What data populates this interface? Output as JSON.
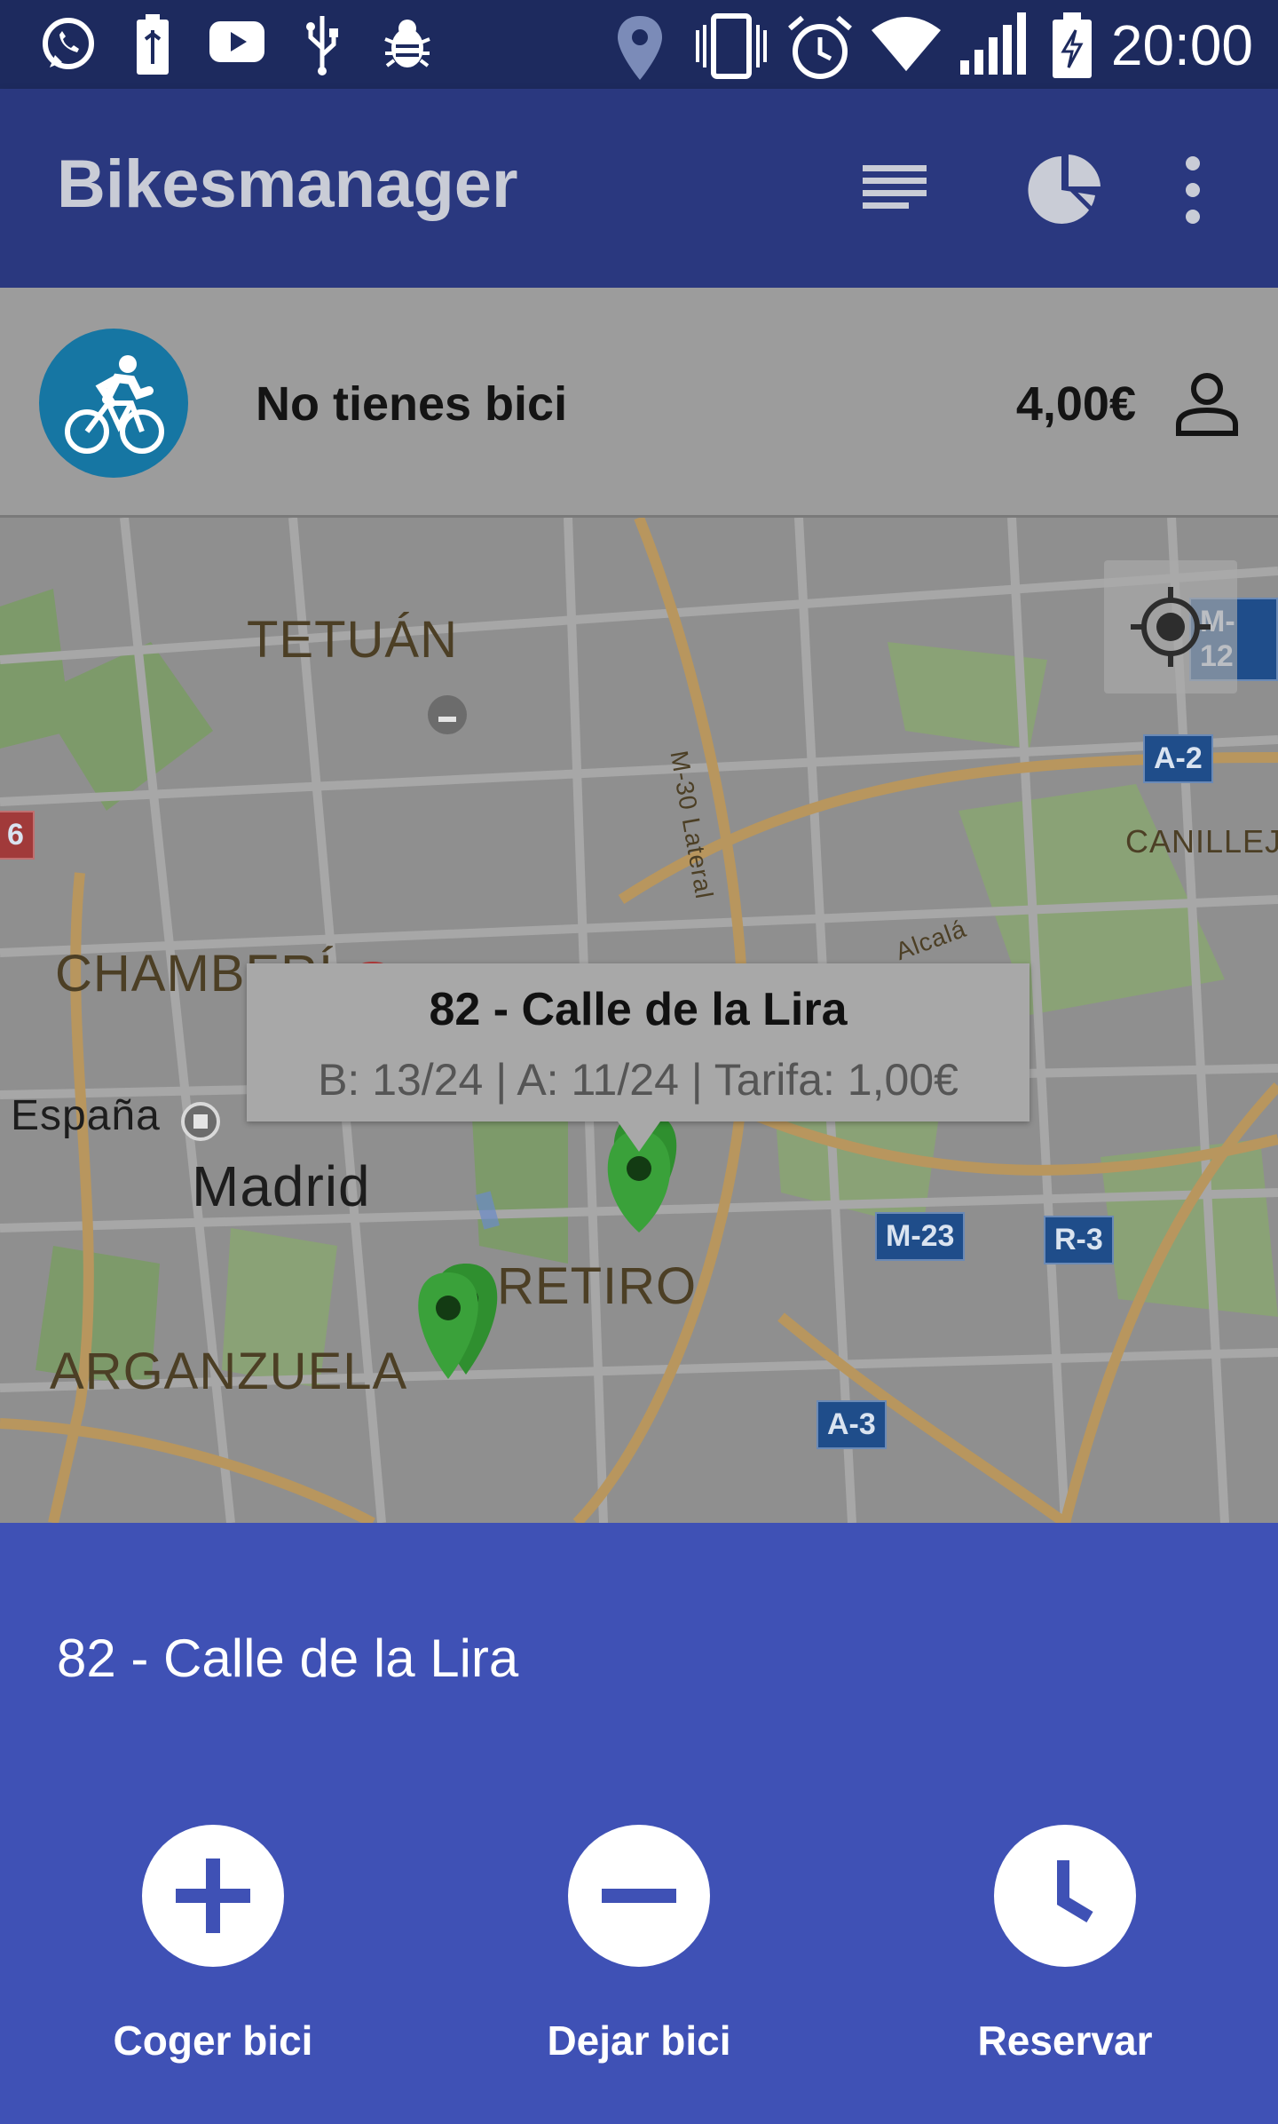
{
  "status_bar": {
    "time": "20:00",
    "icons": [
      "whatsapp-icon",
      "battery-charging-icon",
      "youtube-icon",
      "usb-icon",
      "bug-icon",
      "location-icon",
      "vibrate-icon",
      "alarm-icon",
      "wifi-icon",
      "signal-icon",
      "battery-icon"
    ]
  },
  "app_bar": {
    "title": "Bikesmanager",
    "actions": [
      "list-icon",
      "pie-chart-icon",
      "more-vert-icon"
    ]
  },
  "info_bar": {
    "status": "No tienes bici",
    "balance": "4,00€"
  },
  "map": {
    "labels": {
      "tetuan": "TETUÁN",
      "chamberi": "CHAMBERÍ",
      "espana": "España",
      "madrid": "Madrid",
      "retiro": "RETIRO",
      "arganzuela": "ARGANZUELA",
      "canillejas": "CANILLEJA",
      "m30": "M-30 Lateral",
      "alcala": "Alcalá"
    },
    "shields": {
      "m12": "M-12",
      "a2": "A-2",
      "m23": "M-23",
      "r3": "R-3",
      "a3": "A-3",
      "edge6": "6"
    },
    "info_window": {
      "title": "82 - Calle de la Lira",
      "subtitle": "B: 13/24 | A: 11/24 | Tarifa: 1,00€"
    }
  },
  "bottom_sheet": {
    "title": "82 - Calle de la Lira",
    "actions": {
      "take": "Coger bici",
      "leave": "Dejar bici",
      "reserve": "Reservar"
    }
  }
}
